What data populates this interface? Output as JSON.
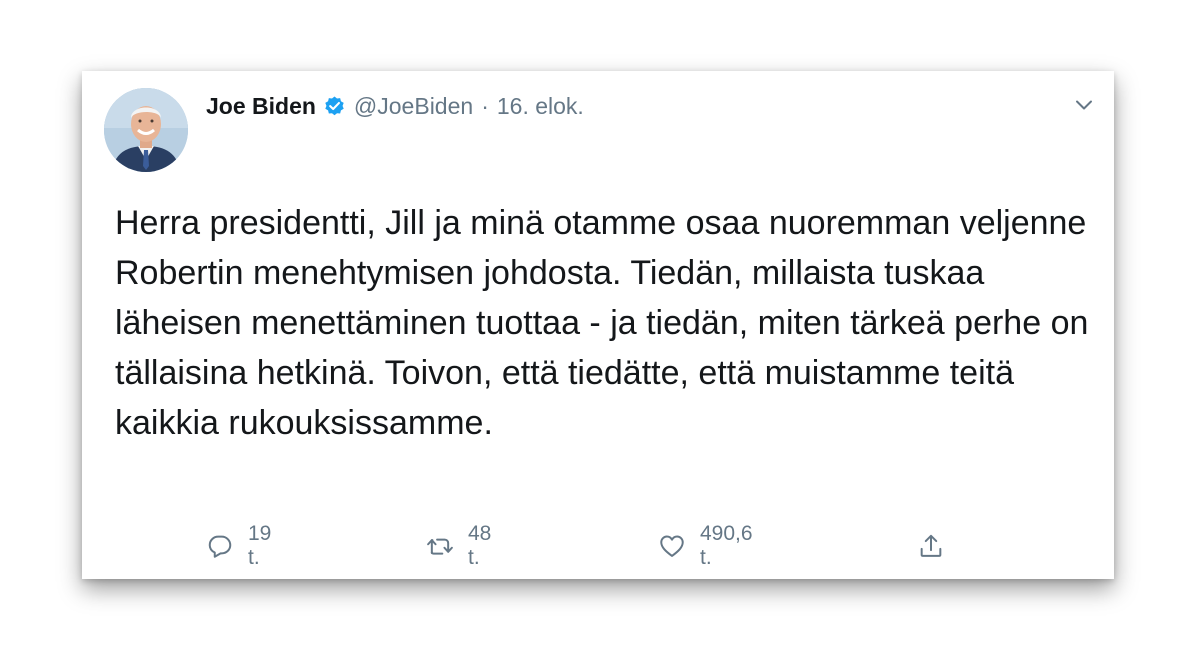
{
  "tweet": {
    "author": {
      "name": "Joe Biden",
      "handle": "@JoeBiden",
      "verified": true
    },
    "separator": "·",
    "date": "16. elok.",
    "text": "Herra presidentti, Jill ja minä otamme osaa nuoremman veljenne Robertin menehtymisen johdosta. Tiedän, millaista tuskaa läheisen menettäminen tuottaa - ja tiedän, miten tärkeä perhe on tällaisina hetkinä. Toivon, että tiedätte, että muistamme teitä kaikkia rukouksissamme.",
    "actions": {
      "replies": "19 t.",
      "retweets": "48 t.",
      "likes": "490,6 t."
    }
  },
  "icons": {
    "verified": "verified-badge-icon",
    "menu": "chevron-down-icon",
    "reply": "reply-icon",
    "retweet": "retweet-icon",
    "like": "heart-icon",
    "share": "share-icon"
  },
  "colors": {
    "text": "#14171a",
    "secondary": "#657786",
    "verified": "#1da1f2"
  }
}
